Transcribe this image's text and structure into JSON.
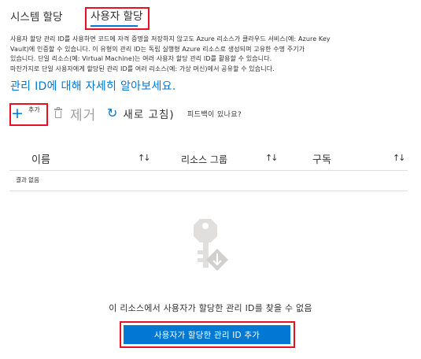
{
  "tabs": {
    "system_assigned": "시스템 할당",
    "user_assigned": "사용자 할당"
  },
  "description": {
    "line1": "사용자 할당 관리 ID를 사용하면 코드에 자격 증명을 저장하지 않고도 Azure 리소스가 클라우드 서비스(예: Azure Key",
    "line2": "Vault)에 인증할 수 있습니다. 이 유형의 관리 ID는 독립 실행형 Azure 리소스로 생성되며 고유한 수명 주기가",
    "line3": "있습니다. 단일 리소스(예: Virtual Machine)는 여러 사용자 할당 관리 ID를 활용할 수 있습니다.",
    "line4": "마찬가지로 단일 사용자에게 할당된 관리 ID를 여러 리소스(예: 가상 머신)에서 공유할 수 있습니다.",
    "learn_more": "관리 ID에 대해 자세히 알아보세요."
  },
  "toolbar": {
    "add_label": "추가",
    "remove_label": "제거",
    "refresh_label": "새로 고침)",
    "feedback_label": "피드백이 있나요?"
  },
  "table": {
    "columns": [
      "이름",
      "리소스 그룹",
      "구독"
    ],
    "sort_glyph": "↑↓",
    "empty_text": "결과 없음"
  },
  "empty_state": {
    "message": "이 리소스에서 사용자가 할당한 관리 ID를 찾을 수 없음",
    "button_label": "사용자가 할당한 관리 ID 추가"
  },
  "colors": {
    "accent": "#0078d4",
    "highlight": "#e81123",
    "disabled": "#a19f9d"
  }
}
